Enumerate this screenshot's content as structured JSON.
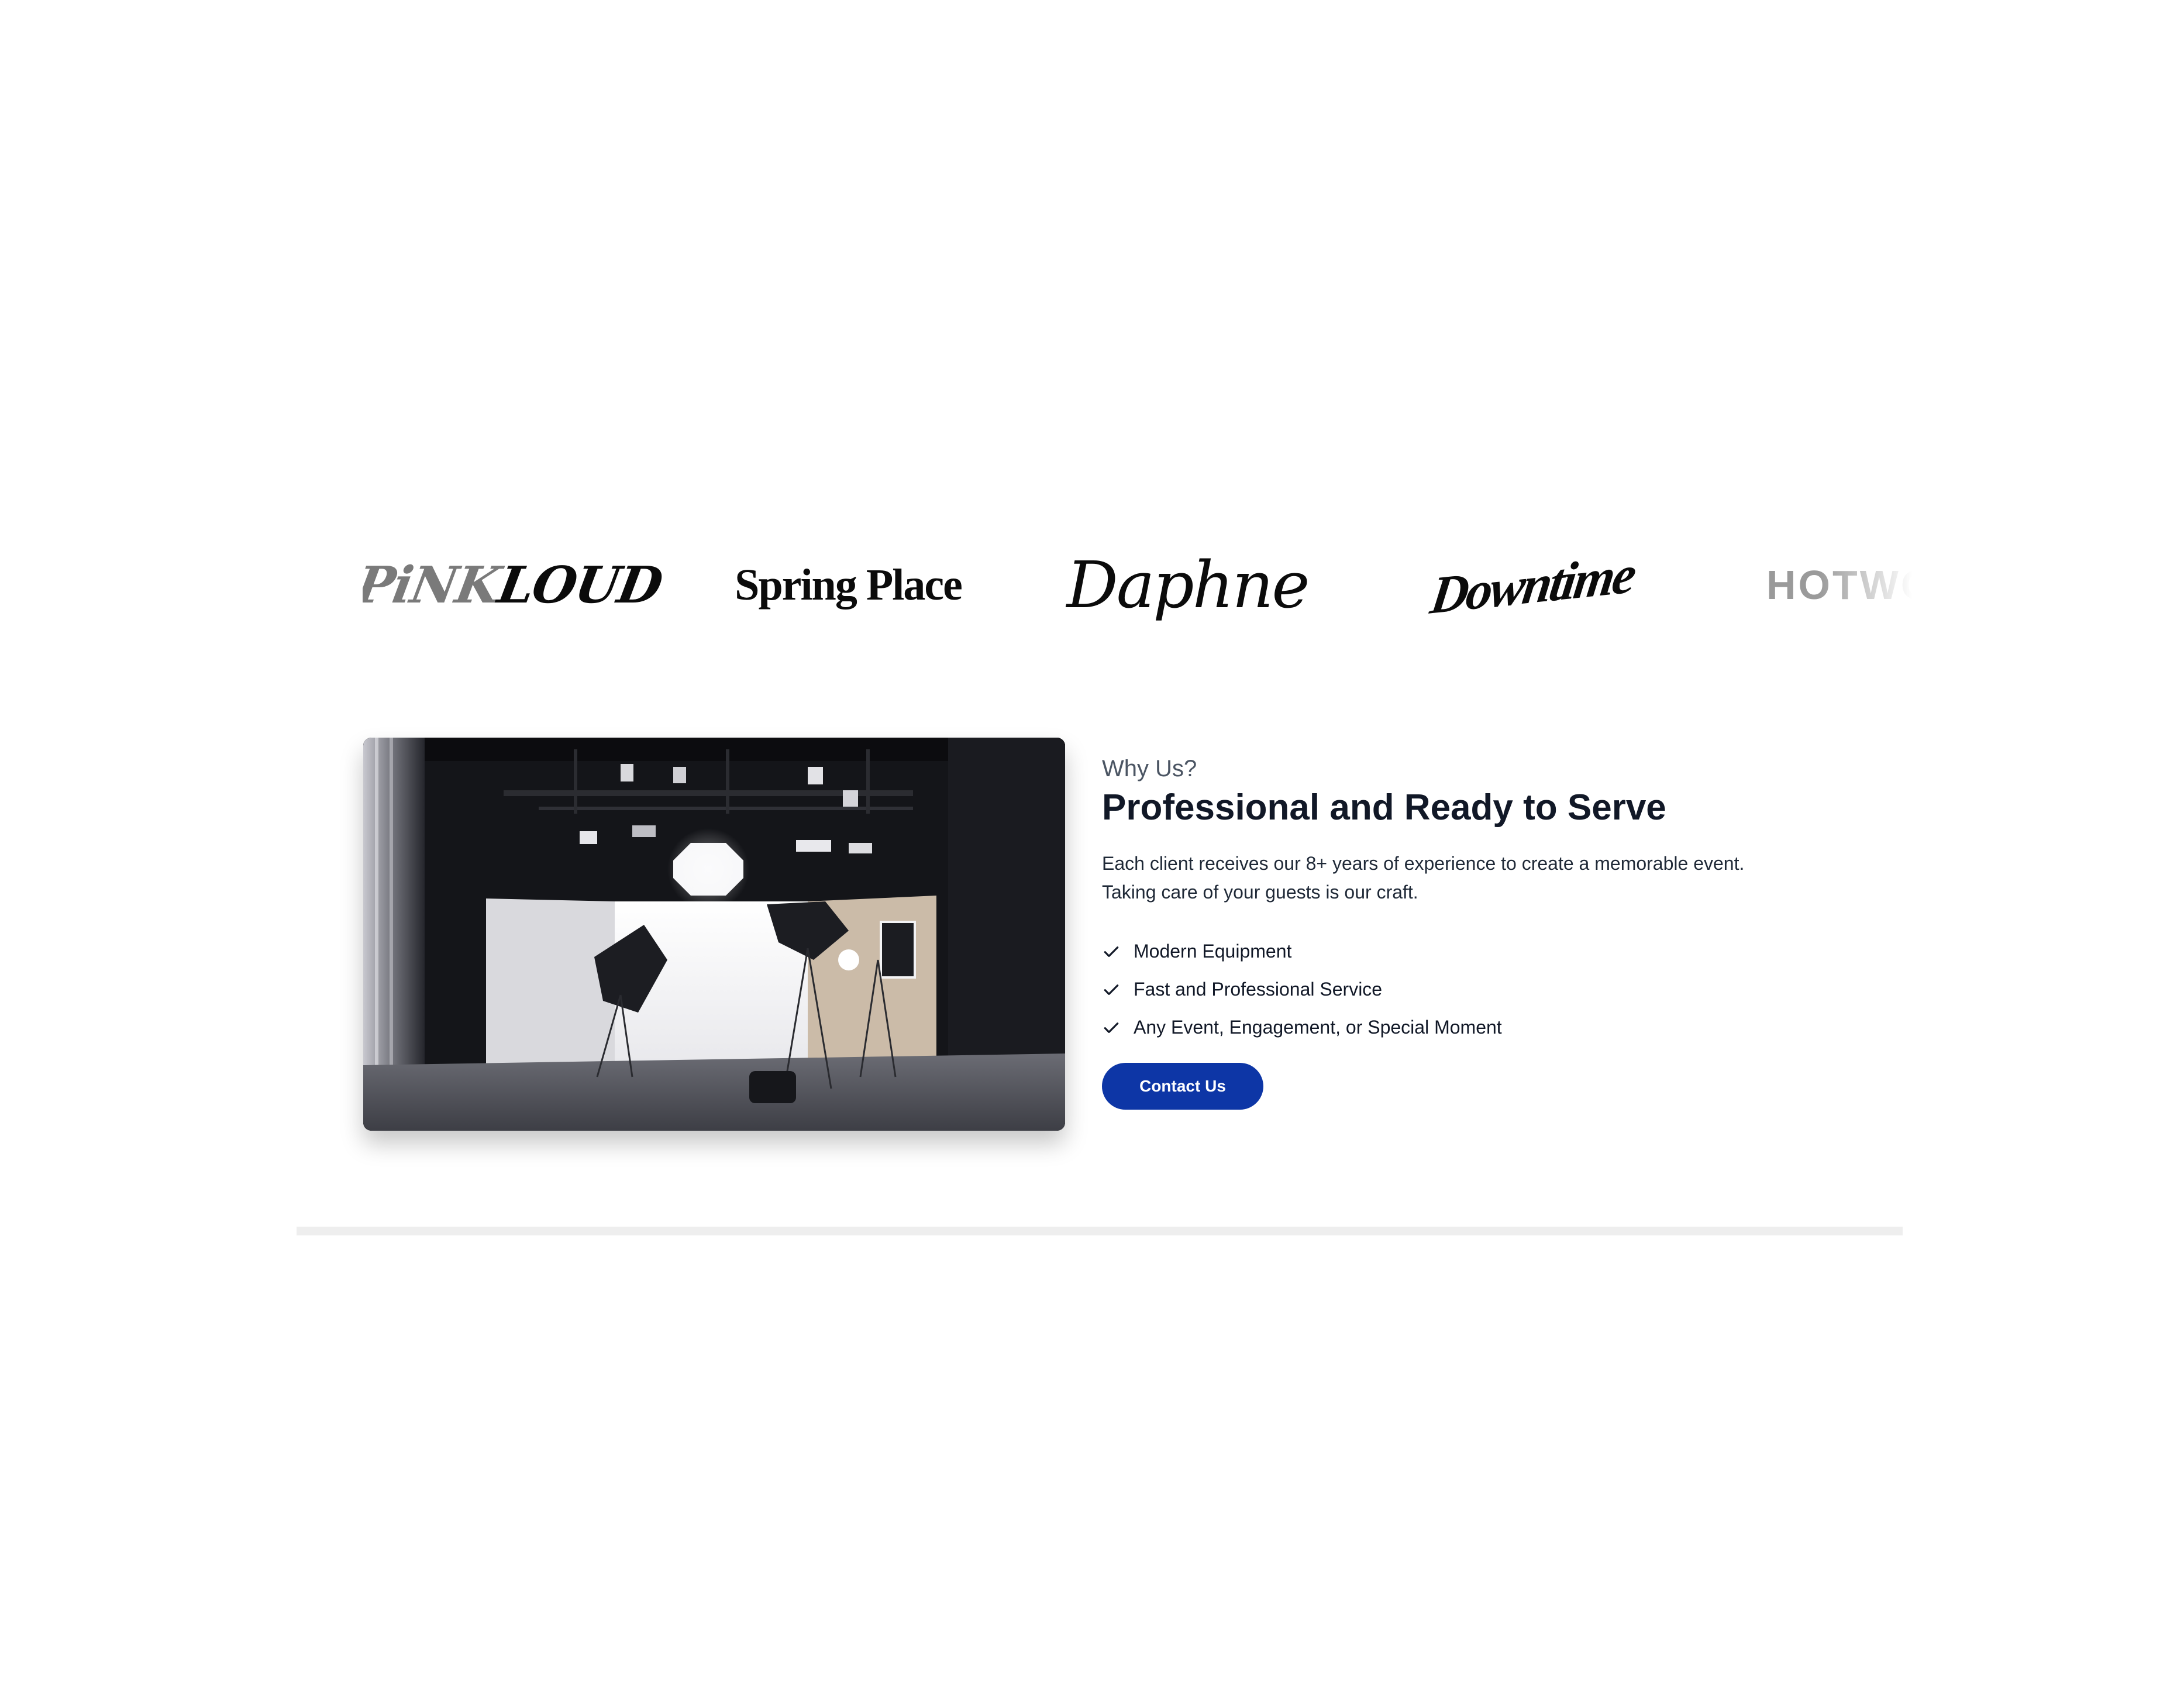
{
  "logos": [
    {
      "name": "pinkloud",
      "parts": [
        "PiNK",
        "LOUD"
      ]
    },
    {
      "name": "spring-place",
      "text": "Spring Place"
    },
    {
      "name": "daphne",
      "text": "Daphne"
    },
    {
      "name": "downtime",
      "text": "Downtime"
    },
    {
      "name": "hotwo",
      "text": "HOTWO"
    }
  ],
  "section": {
    "eyebrow": "Why Us?",
    "headline": "Professional and Ready to Serve",
    "description": [
      "Each client receives our 8+ years of experience to create a memorable event.",
      "Taking care of your guests is our craft."
    ],
    "features": [
      "Modern Equipment",
      "Fast and Professional Service",
      "Any Event, Engagement, or Special Moment"
    ],
    "cta_label": "Contact Us",
    "cta_color": "#0d36a6"
  },
  "icons": {
    "feature_check": "check-icon"
  }
}
